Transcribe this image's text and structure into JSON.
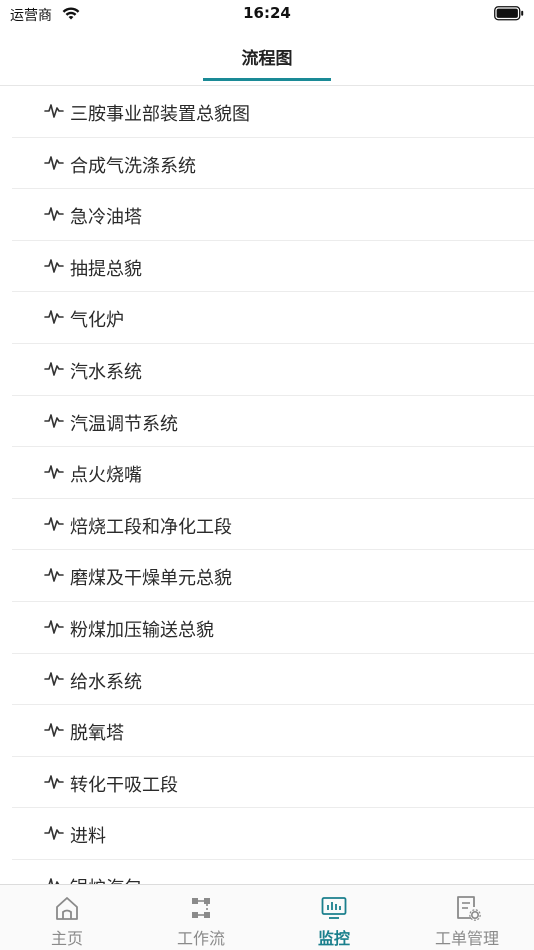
{
  "status_bar": {
    "carrier": "运营商",
    "time": "16:24"
  },
  "header": {
    "title": "流程图"
  },
  "colors": {
    "accent": "#1a8a96"
  },
  "list": [
    {
      "label": "三胺事业部装置总貌图",
      "icon": "waveform-icon"
    },
    {
      "label": "合成气洗涤系统",
      "icon": "waveform-icon"
    },
    {
      "label": "急冷油塔",
      "icon": "waveform-icon"
    },
    {
      "label": "抽提总貌",
      "icon": "waveform-icon"
    },
    {
      "label": "气化炉",
      "icon": "waveform-icon"
    },
    {
      "label": "汽水系统",
      "icon": "waveform-icon"
    },
    {
      "label": "汽温调节系统",
      "icon": "waveform-icon"
    },
    {
      "label": "点火烧嘴",
      "icon": "waveform-icon"
    },
    {
      "label": "焙烧工段和净化工段",
      "icon": "waveform-icon"
    },
    {
      "label": "磨煤及干燥单元总貌",
      "icon": "waveform-icon"
    },
    {
      "label": "粉煤加压输送总貌",
      "icon": "waveform-icon"
    },
    {
      "label": "给水系统",
      "icon": "waveform-icon"
    },
    {
      "label": "脱氧塔",
      "icon": "waveform-icon"
    },
    {
      "label": "转化干吸工段",
      "icon": "waveform-icon"
    },
    {
      "label": "进料",
      "icon": "waveform-icon"
    },
    {
      "label": "锅炉汽包",
      "icon": "waveform-icon"
    }
  ],
  "tab_bar": {
    "tabs": [
      {
        "label": "主页",
        "icon": "home-icon",
        "active": false
      },
      {
        "label": "工作流",
        "icon": "workflow-icon",
        "active": false
      },
      {
        "label": "监控",
        "icon": "monitor-icon",
        "active": true
      },
      {
        "label": "工单管理",
        "icon": "work-order-icon",
        "active": false
      }
    ]
  }
}
